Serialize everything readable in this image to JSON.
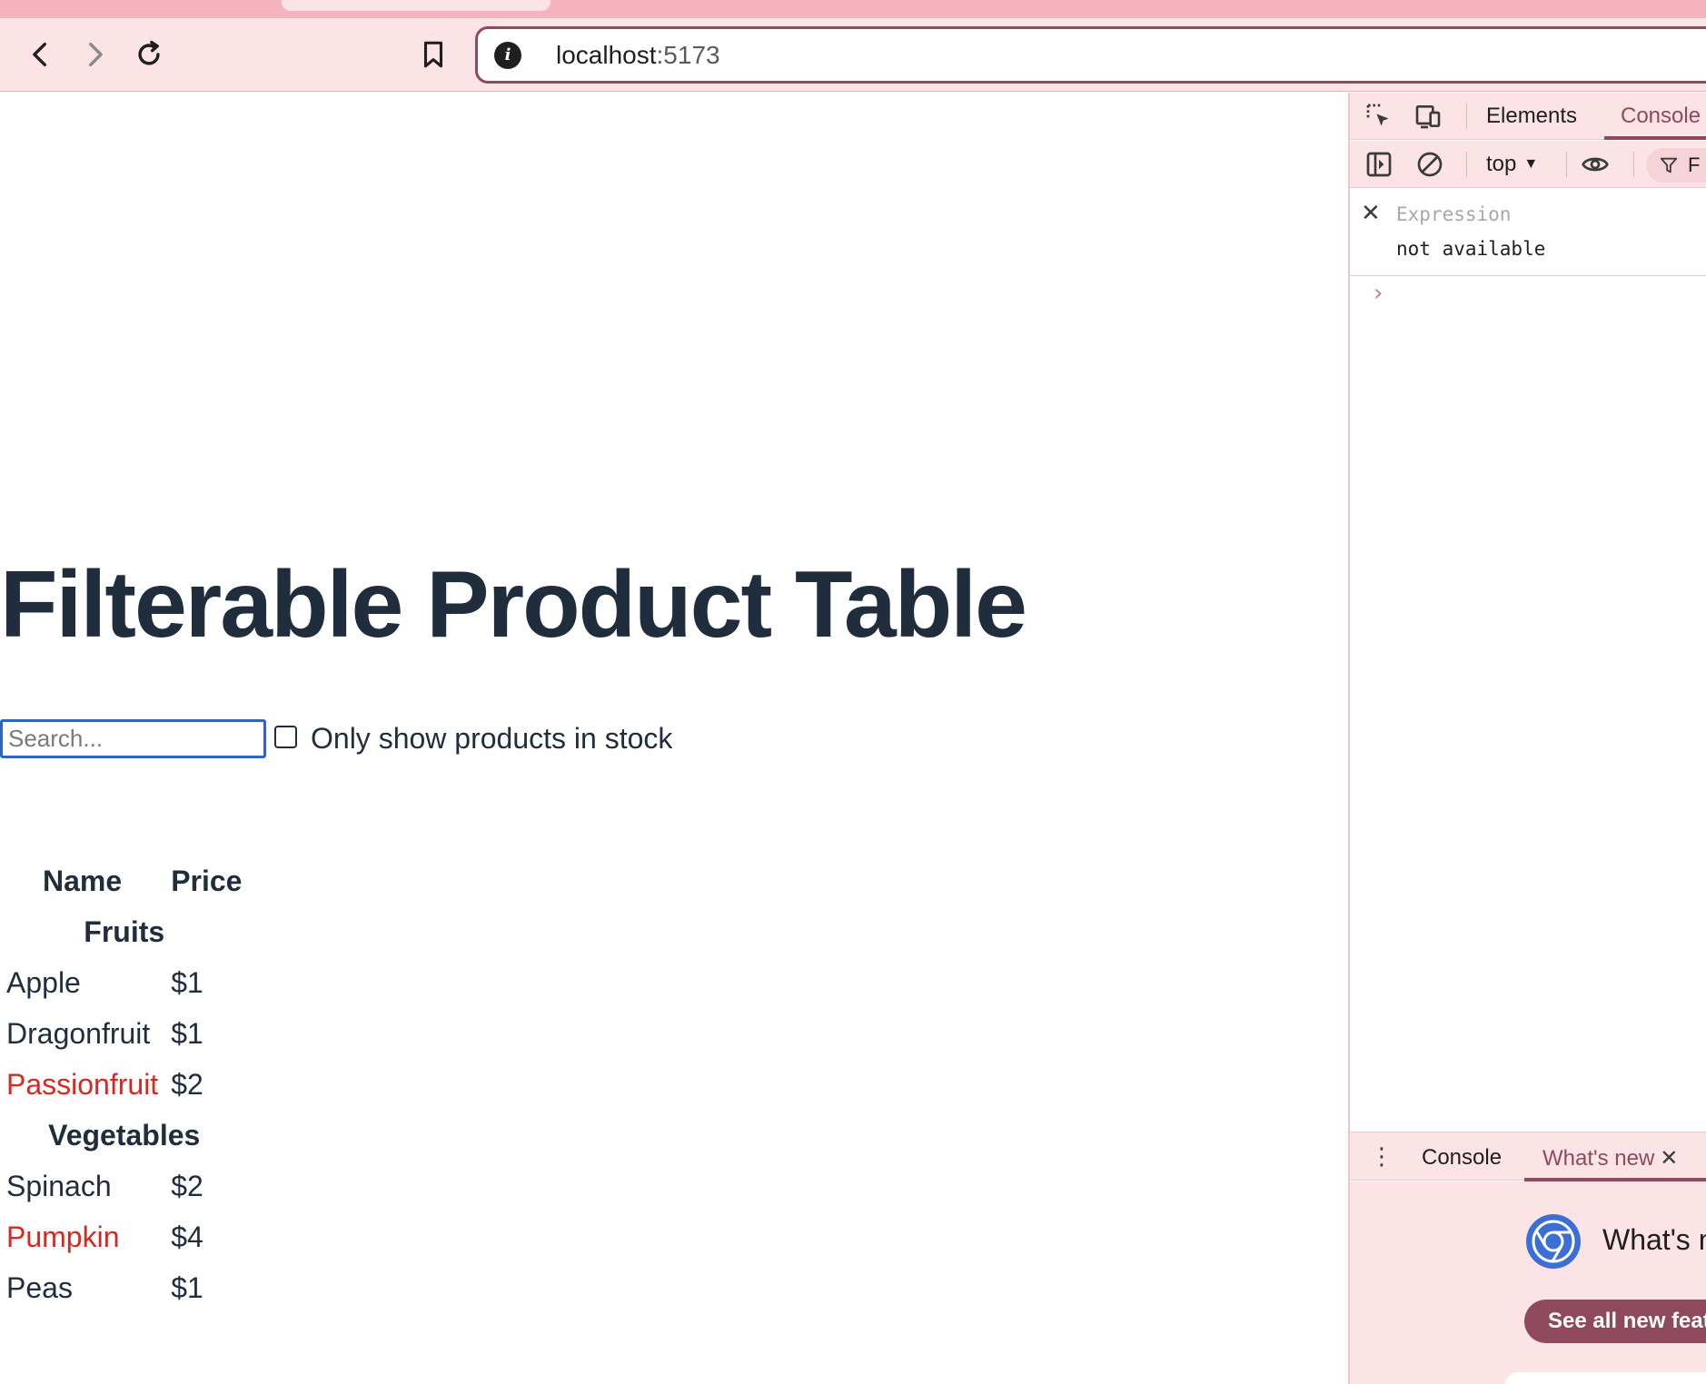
{
  "browser": {
    "url_host": "localhost",
    "url_port": ":5173",
    "icons": [
      "back-icon",
      "forward-icon",
      "reload-icon",
      "bookmark-icon",
      "site-info-icon"
    ]
  },
  "page": {
    "title": "Filterable Product Table",
    "search": {
      "placeholder": "Search...",
      "value": ""
    },
    "stock_filter": {
      "label": "Only show products in stock",
      "checked": false
    },
    "table": {
      "headers": [
        "Name",
        "Price"
      ],
      "categories": [
        {
          "name": "Fruits",
          "products": [
            {
              "name": "Apple",
              "price": "$1",
              "stocked": true
            },
            {
              "name": "Dragonfruit",
              "price": "$1",
              "stocked": true
            },
            {
              "name": "Passionfruit",
              "price": "$2",
              "stocked": false
            }
          ]
        },
        {
          "name": "Vegetables",
          "products": [
            {
              "name": "Spinach",
              "price": "$2",
              "stocked": true
            },
            {
              "name": "Pumpkin",
              "price": "$4",
              "stocked": false
            },
            {
              "name": "Peas",
              "price": "$1",
              "stocked": true
            }
          ]
        }
      ]
    },
    "out_of_stock_color": "#d6291f"
  },
  "devtools": {
    "tabs": [
      "Elements",
      "Console"
    ],
    "active_tab": "Console",
    "context": "top",
    "filter_label": "F",
    "live_expression": {
      "placeholder": "Expression",
      "value": "not available"
    },
    "prompt": "›",
    "drawer": {
      "tabs": [
        "Console",
        "What's new"
      ],
      "active_tab": "What's new",
      "whats_new_title": "What's n",
      "see_all_button": "See all new feat"
    },
    "accent_color": "#8e4a5c"
  }
}
